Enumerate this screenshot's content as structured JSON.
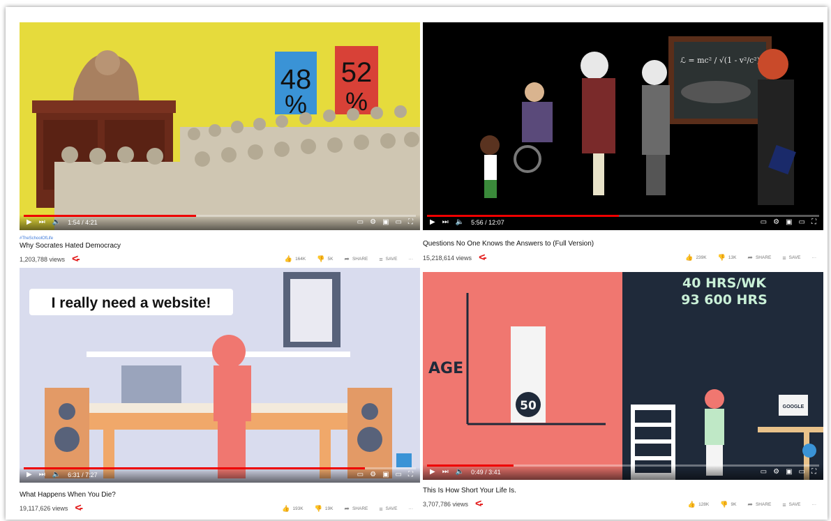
{
  "videos": [
    {
      "channel": "#TheSchoolOfLife",
      "title": "Why Socrates Hated Democracy",
      "views": "1,203,788 views",
      "time": "1:54 / 4:21",
      "progress": 0.44,
      "likes": "164K",
      "dislikes": "5K",
      "overlay": {
        "pct_left": "48",
        "pct_right": "52",
        "pct_sign": "%"
      }
    },
    {
      "title": "Questions No One Knows the Answers to (Full Version)",
      "views": "15,218,614 views",
      "time": "5:56 / 12:07",
      "progress": 0.49,
      "likes": "239K",
      "dislikes": "13K",
      "overlay": {
        "formula": "ℒ = mc² / √(1 - v²/c²)"
      }
    },
    {
      "title": "What Happens When You Die?",
      "views": "19,117,626 views",
      "time": "6:31 / 7:27",
      "progress": 0.87,
      "likes": "193K",
      "dislikes": "19K",
      "overlay": {
        "speech": "I really need a website!"
      }
    },
    {
      "title": "This Is How Short Your Life Is.",
      "views": "3,707,786 views",
      "time": "0:49 / 3:41",
      "progress": 0.22,
      "likes": "128K",
      "dislikes": "9K",
      "overlay": {
        "hrs_top": "40 HRS/WK",
        "hrs_bottom": "93 600 HRS",
        "age": "AGE",
        "age_value": "50",
        "computer_label": "GOOGLE"
      }
    }
  ],
  "actions": {
    "share": "SHARE",
    "save": "SAVE",
    "more": "···"
  },
  "colors": {
    "red": "#e31a1a",
    "yellow": "#e6db3c",
    "salmon": "#f07770",
    "navy": "#1f2a3a",
    "blue_overlay": "#3a93d6",
    "red_overlay": "#d84137",
    "light_lavender": "#d9dcee"
  }
}
